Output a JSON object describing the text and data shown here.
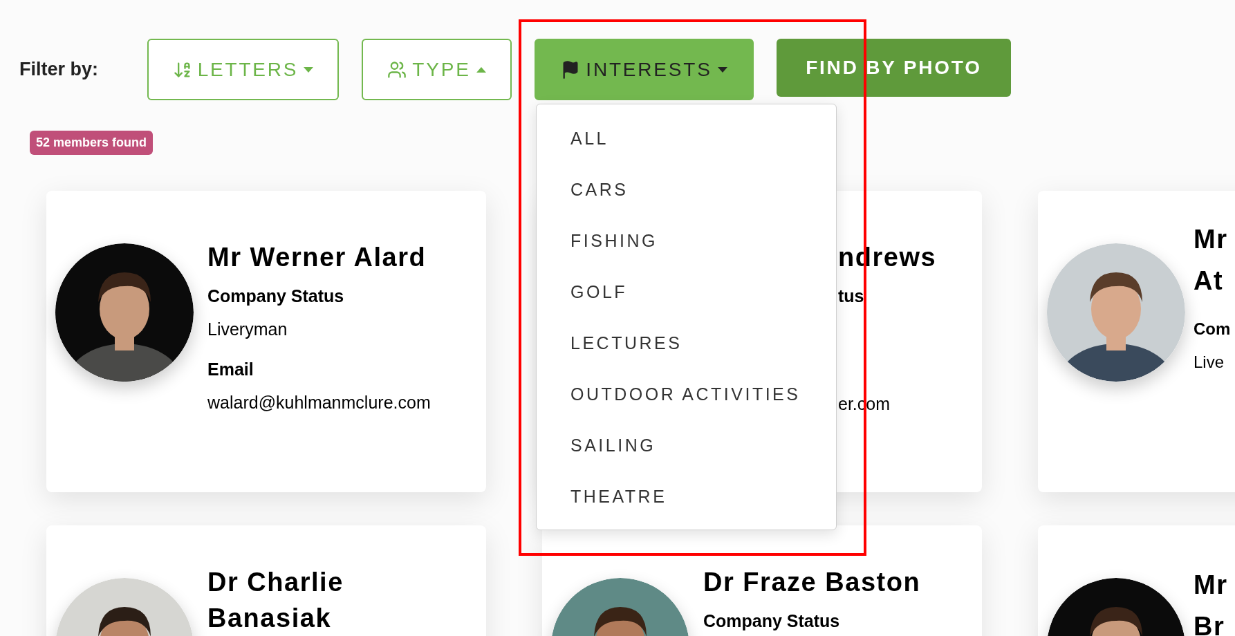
{
  "filter_label": "Filter by:",
  "filters": [
    {
      "label": "LETTERS",
      "caret_up": false,
      "selected": false,
      "expanded": false
    },
    {
      "label": "TYPE",
      "caret_up": true,
      "selected": false,
      "expanded": false
    },
    {
      "label": "INTERESTS",
      "caret_up": false,
      "selected": true,
      "expanded": true
    }
  ],
  "photo_button": "FIND BY PHOTO",
  "results_badge": "52 members found",
  "interests_menu": [
    "ALL",
    "CARS",
    "FISHING",
    "GOLF",
    "LECTURES",
    "OUTDOOR ACTIVITIES",
    "SAILING",
    "THEATRE"
  ],
  "member_rows": [
    [
      {
        "kind": "full",
        "name": "Mr Werner Alard",
        "fields": [
          {
            "kind": "label",
            "text": "Company Status"
          },
          {
            "kind": "value",
            "text": "Liveryman"
          },
          {
            "kind": "label",
            "text": "Email"
          },
          {
            "kind": "value",
            "text": "walard@kuhlmanmclure.com"
          }
        ]
      },
      {
        "kind": "covered",
        "name": "ndrews",
        "fields": [
          {
            "kind": "label",
            "text": "tus"
          },
          {
            "kind": "value",
            "text": "er.com"
          }
        ]
      },
      {
        "kind": "edge",
        "name": "Mr At",
        "fields": [
          {
            "kind": "label",
            "text": "Com"
          },
          {
            "kind": "value",
            "text": "Live"
          }
        ]
      }
    ],
    [
      {
        "kind": "full",
        "name": "Dr Charlie Banasiak"
      },
      {
        "kind": "full",
        "name": "Dr Fraze Baston",
        "fields": [
          {
            "kind": "label",
            "text": "Company Status"
          }
        ]
      },
      {
        "kind": "edge",
        "name": "Mr Br"
      }
    ]
  ]
}
